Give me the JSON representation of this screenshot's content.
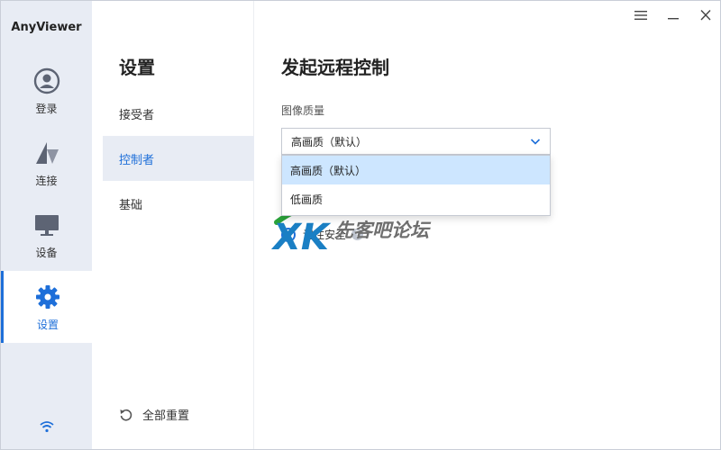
{
  "app": {
    "title": "AnyViewer"
  },
  "leftnav": {
    "items": [
      {
        "label": "登录",
        "icon": "user-icon"
      },
      {
        "label": "连接",
        "icon": "connect-icon"
      },
      {
        "label": "设备",
        "icon": "monitor-icon"
      },
      {
        "label": "设置",
        "icon": "gear-icon"
      }
    ],
    "active_index": 3
  },
  "submenu": {
    "title": "设置",
    "items": [
      {
        "label": "接受者"
      },
      {
        "label": "控制者"
      },
      {
        "label": "基础"
      }
    ],
    "active_index": 1,
    "reset_label": "全部重置"
  },
  "content": {
    "title": "发起远程控制",
    "image_quality": {
      "label": "图像质量",
      "selected": "高画质（默认）",
      "options": [
        "高画质（默认）",
        "低画质"
      ]
    },
    "remember_label": "记住安全"
  },
  "watermark": {
    "text": "先客吧论坛",
    "logo": "XK"
  },
  "colors": {
    "accent": "#1e6fd9",
    "sidebar_bg": "#e8ecf4",
    "option_highlight": "#cde6ff"
  }
}
